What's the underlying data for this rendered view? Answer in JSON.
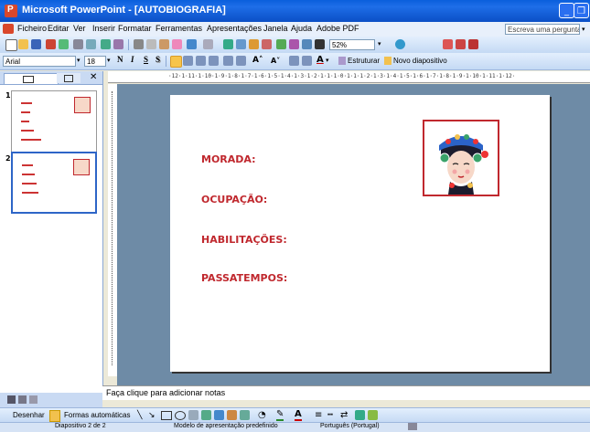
{
  "window": {
    "title": "Microsoft PowerPoint - [AUTOBIOGRAFIA]",
    "app_icon_letter": "P"
  },
  "menu": {
    "items": [
      "Ficheiro",
      "Editar",
      "Ver",
      "Inserir",
      "Formatar",
      "Ferramentas",
      "Apresentações",
      "Janela",
      "Ajuda",
      "Adobe PDF"
    ],
    "help_placeholder": "Escreva uma pergunta"
  },
  "toolbar": {
    "zoom": "52%"
  },
  "format_toolbar": {
    "font": "Arial",
    "size": "18",
    "bold": "N",
    "italic": "I",
    "underline": "S",
    "shadow": "S",
    "design_label": "Estruturar",
    "new_slide_label": "Novo diapositivo"
  },
  "ruler": {
    "marks": "·12·1·11·1·10·1·9·1·8·1·7·1·6·1·5·1·4·1·3·1·2·1·1·1·0·1·1·1·2·1·3·1·4·1·5·1·6·1·7·1·8·1·9·1·10·1·11·1·12·"
  },
  "thumbnails": [
    {
      "number": "1"
    },
    {
      "number": "2"
    }
  ],
  "slide": {
    "fields": [
      "MORADA:",
      "OCUPAÇÃO:",
      "HABILITAÇÕES:",
      "PASSATEMPOS:"
    ]
  },
  "notes": {
    "placeholder": "Faça clique para adicionar notas"
  },
  "draw_toolbar": {
    "draw_label": "Desenhar",
    "autoshapes_label": "Formas automáticas"
  },
  "status": {
    "slide": "Diapositivo 2 de 2",
    "template": "Modelo de apresentação predefinido",
    "language": "Português (Portugal)"
  },
  "colors": {
    "accent_red": "#c0282e",
    "title_blue": "#0b4fc6",
    "workspace": "#6e8ba6"
  }
}
